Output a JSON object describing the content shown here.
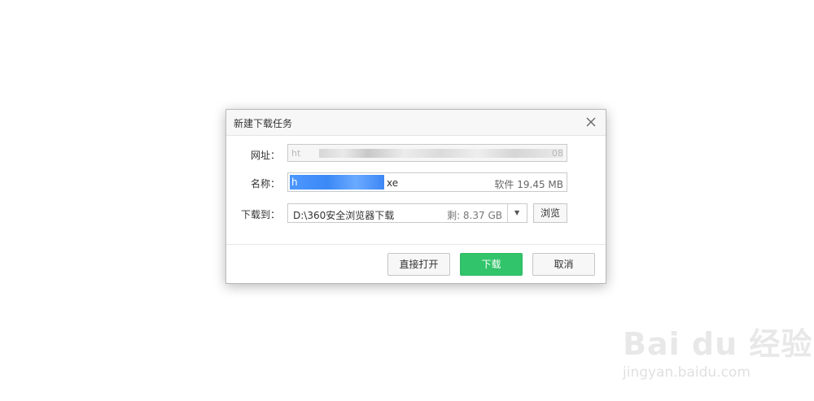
{
  "dialog": {
    "title": "新建下载任务",
    "url_label": "网址：",
    "url_value": "ht",
    "url_value_tail": "08",
    "name_label": "名称：",
    "name_value_suffix": "xe",
    "name_prefix_char": "h",
    "file_type_size": "软件 19.45 MB",
    "save_to_label": "下载到：",
    "save_path": "D:\\360安全浏览器下载",
    "free_space": "剩: 8.37 GB",
    "browse_label": "浏览",
    "open_direct_label": "直接打开",
    "download_label": "下载",
    "cancel_label": "取消"
  },
  "watermark": {
    "brand": "Bai du 经验",
    "url": "jingyan.baidu.com"
  },
  "colors": {
    "accent_green": "#32c46a",
    "selection_blue": "#3b89f6"
  },
  "icons": {
    "close": "close-icon",
    "dropdown": "chevron-down-icon"
  }
}
